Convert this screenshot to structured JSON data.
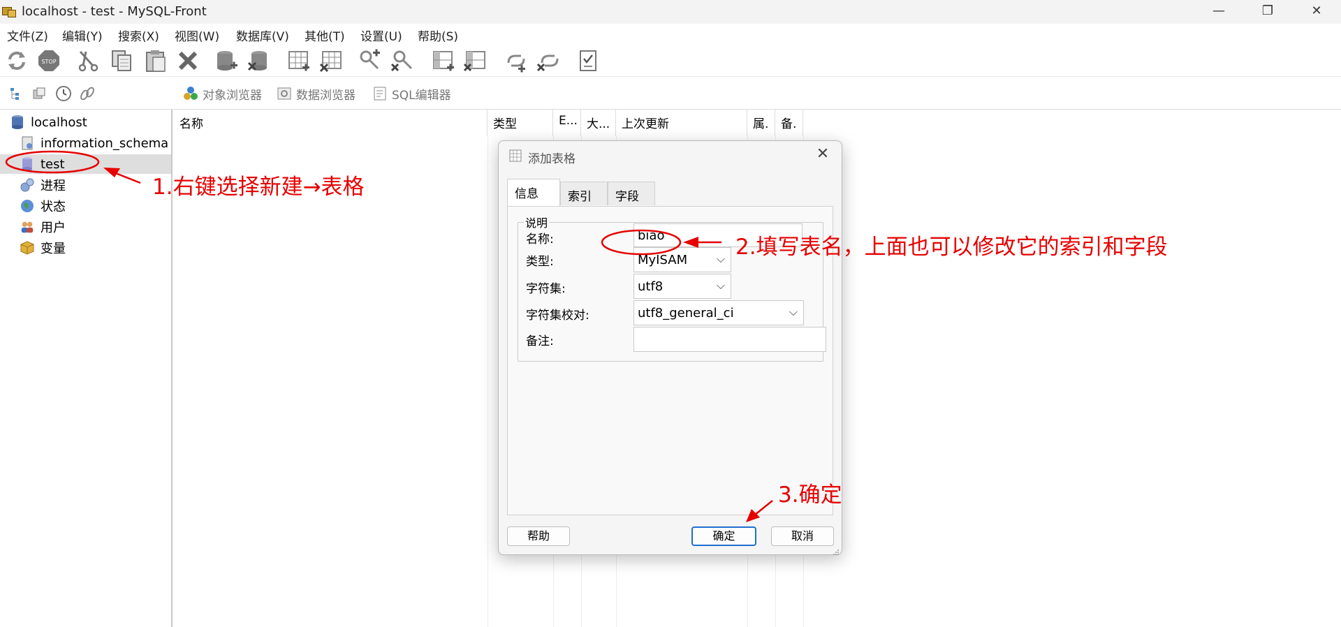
{
  "window": {
    "title": "localhost - test - MySQL-Front",
    "controls": [
      "—",
      "❐",
      "✕"
    ]
  },
  "menu": [
    "文件(Z)",
    "编辑(Y)",
    "搜索(X)",
    "视图(W)",
    "数据库(V)",
    "其他(T)",
    "设置(U)",
    "帮助(S)"
  ],
  "toolbar2": {
    "object_browser": "对象浏览器",
    "data_browser": "数据浏览器",
    "sql_editor": "SQL编辑器"
  },
  "tree": {
    "root": "localhost",
    "items": [
      "information_schema",
      "test",
      "进程",
      "状态",
      "用户",
      "变量"
    ]
  },
  "grid": {
    "columns": [
      "名称",
      "类型",
      "Ε...",
      "大...",
      "上次更新",
      "属.",
      "备."
    ]
  },
  "dialog": {
    "title": "添加表格",
    "tabs": [
      "信息",
      "索引",
      "字段"
    ],
    "group_label": "说明",
    "labels": {
      "name": "名称:",
      "type": "类型:",
      "charset": "字符集:",
      "collation": "字符集校对:",
      "comment": "备注:"
    },
    "values": {
      "name": "biao",
      "type": "MyISAM",
      "charset": "utf8",
      "collation": "utf8_general_ci",
      "comment": ""
    },
    "buttons": {
      "help": "帮助",
      "ok": "确定",
      "cancel": "取消"
    }
  },
  "annotations": {
    "step1": "1.右键选择新建→表格",
    "step2": "2.填写表名，上面也可以修改它的索引和字段",
    "step3": "3.确定"
  },
  "colors": {
    "annotation": "#e60000",
    "accent": "#1f6fcf"
  }
}
